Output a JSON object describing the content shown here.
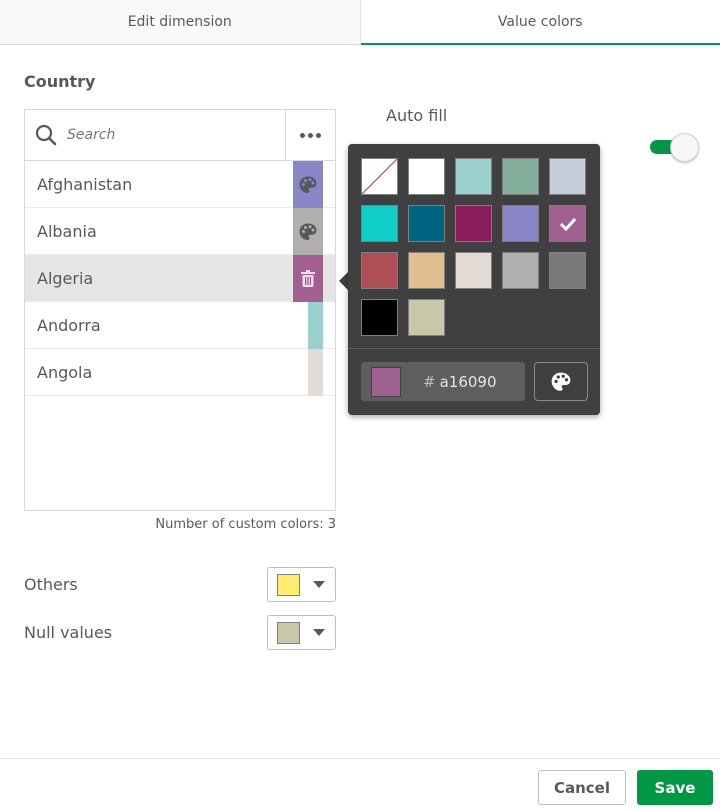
{
  "tabs": [
    {
      "label": "Edit dimension",
      "active": false
    },
    {
      "label": "Value colors",
      "active": true
    }
  ],
  "section_title": "Country",
  "search": {
    "placeholder": "Search",
    "value": ""
  },
  "more_icon": "more-horizontal-icon",
  "values": [
    {
      "label": "Afghanistan",
      "color": "#8a85c6",
      "icon": "palette-icon",
      "custom": true
    },
    {
      "label": "Albania",
      "color": "#b0afae",
      "icon": "palette-icon",
      "custom": true
    },
    {
      "label": "Algeria",
      "color": "#a16090",
      "icon": "trash-icon",
      "custom": true,
      "selected": true
    },
    {
      "label": "Andorra",
      "color": "#99cfcd",
      "custom": false
    },
    {
      "label": "Angola",
      "color": "#e3dcd6",
      "custom": false
    }
  ],
  "custom_count_label": "Number of custom colors: 3",
  "others": {
    "label": "Others",
    "color": "#ffec6e"
  },
  "null_values": {
    "label": "Null values",
    "color": "#c8c7a9"
  },
  "auto_fill": {
    "label": "Auto fill",
    "enabled": true
  },
  "picker": {
    "swatches": [
      {
        "name": "none",
        "color": "#ffffff",
        "none": true
      },
      {
        "name": "white",
        "color": "#ffffff"
      },
      {
        "name": "light-teal",
        "color": "#99cfcd"
      },
      {
        "name": "sage",
        "color": "#82ae9b"
      },
      {
        "name": "light-gray-blue",
        "color": "#c5ced9"
      },
      {
        "name": "turquoise",
        "color": "#10cfc9"
      },
      {
        "name": "petrol",
        "color": "#006580"
      },
      {
        "name": "plum",
        "color": "#891d5a"
      },
      {
        "name": "lavender",
        "color": "#8a85c6"
      },
      {
        "name": "mauve",
        "color": "#a16090",
        "selected": true
      },
      {
        "name": "red",
        "color": "#ae4f58"
      },
      {
        "name": "sand",
        "color": "#e1be8e"
      },
      {
        "name": "light-beige",
        "color": "#e3dcd6"
      },
      {
        "name": "gray",
        "color": "#b0afae"
      },
      {
        "name": "dark-gray",
        "color": "#7b7a78"
      },
      {
        "name": "black",
        "color": "#000000"
      },
      {
        "name": "khaki",
        "color": "#c8c7a9"
      }
    ],
    "hash": "#",
    "hex_value": "a16090",
    "current_color": "#a16090"
  },
  "buttons": {
    "cancel": "Cancel",
    "save": "Save"
  },
  "accent_color": "#009845"
}
